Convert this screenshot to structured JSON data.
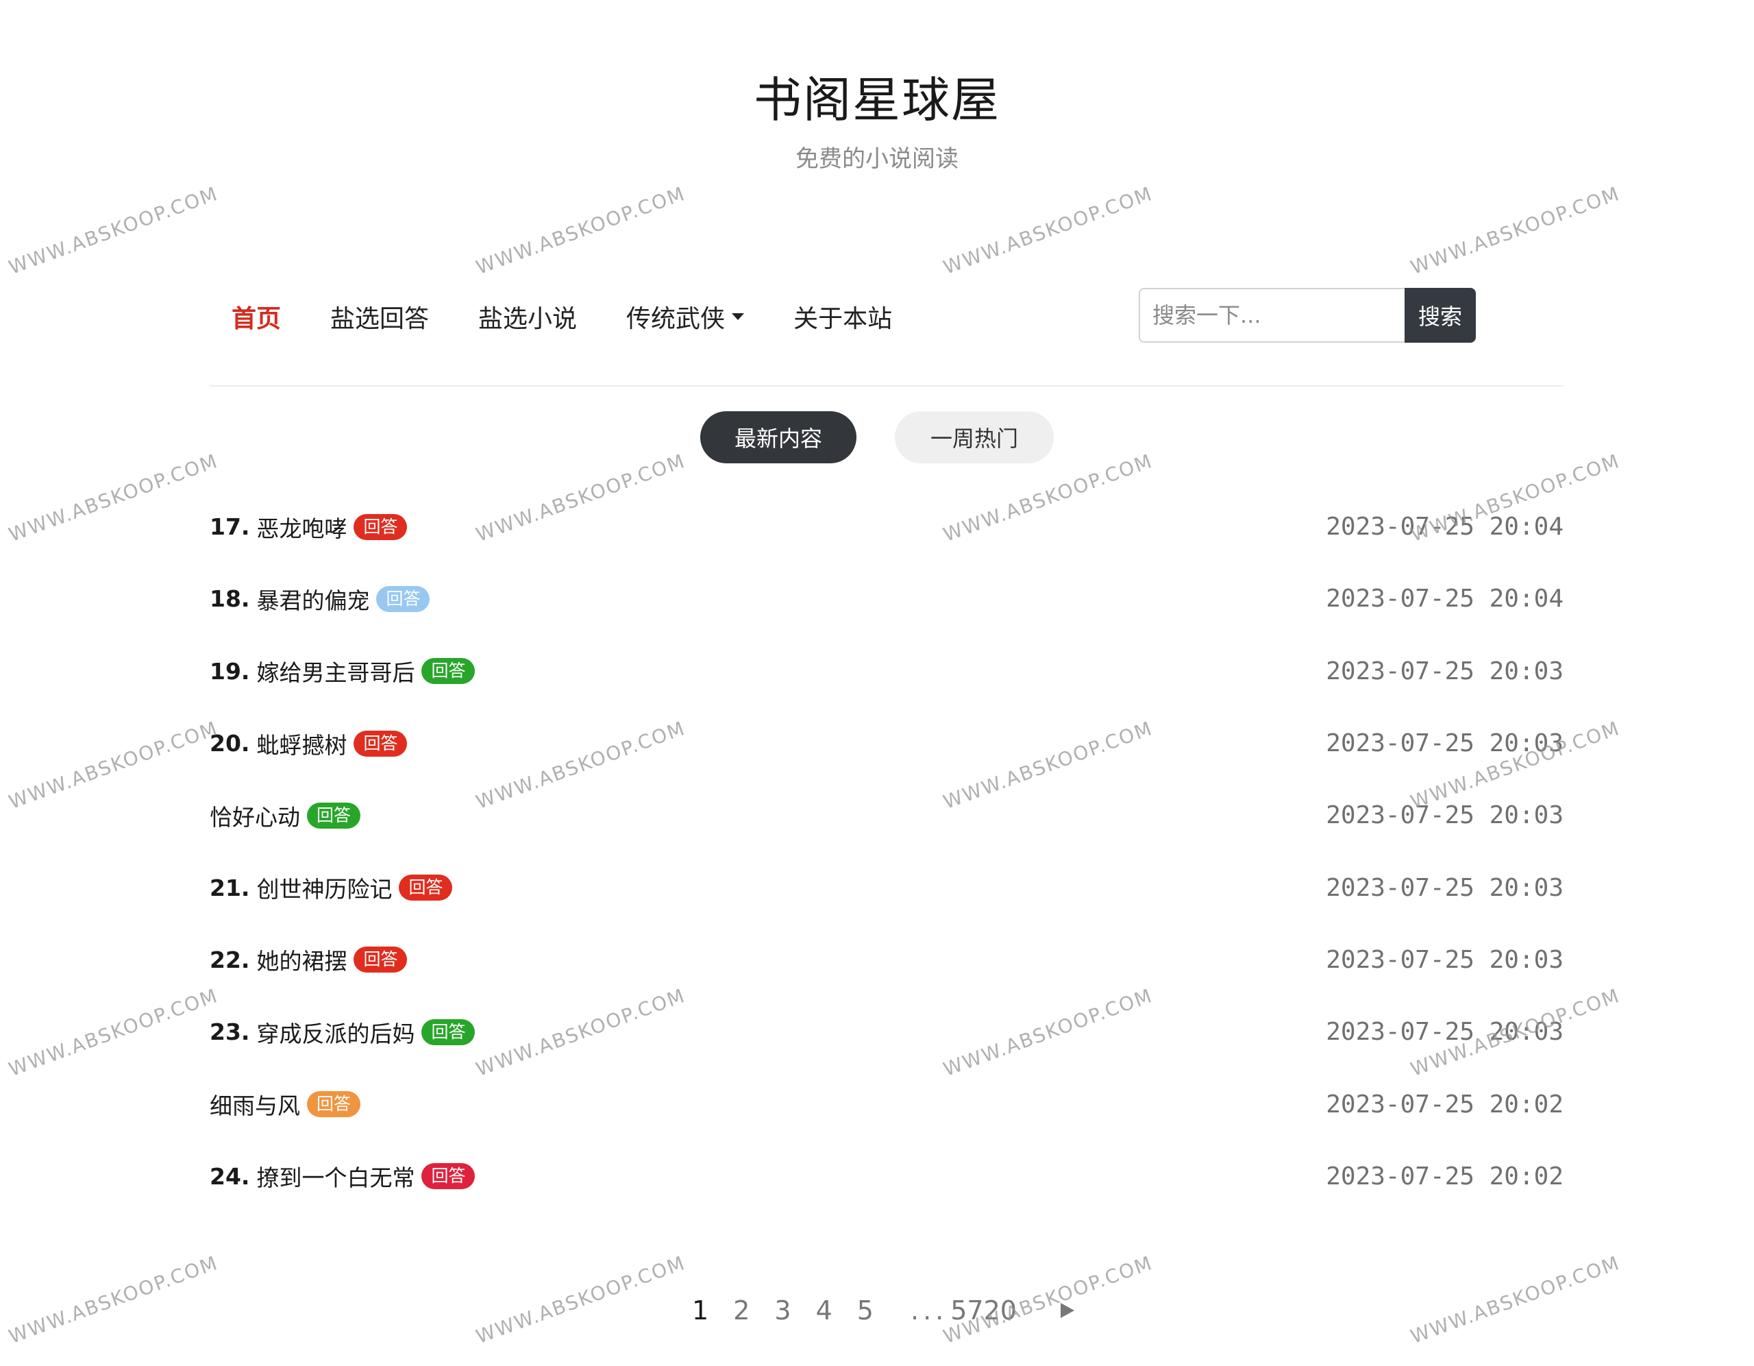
{
  "header": {
    "title": "书阁星球屋",
    "subtitle": "免费的小说阅读"
  },
  "nav": {
    "items": [
      {
        "label": "首页",
        "active": true
      },
      {
        "label": "盐选回答",
        "active": false
      },
      {
        "label": "盐选小说",
        "active": false
      },
      {
        "label": "传统武侠",
        "active": false,
        "dropdown": true
      },
      {
        "label": "关于本站",
        "active": false
      }
    ]
  },
  "search": {
    "placeholder": "搜索一下...",
    "button_label": "搜索"
  },
  "tabs": [
    {
      "label": "最新内容",
      "active": true
    },
    {
      "label": "一周热门",
      "active": false
    }
  ],
  "colors": {
    "accent": "#d42a1e",
    "dark": "#343a40",
    "badge_red": "#e02d1f",
    "badge_blue": "#98c8f2",
    "badge_green": "#28a62a",
    "badge_orange": "#f19440",
    "badge_crimson": "#e0213d"
  },
  "list": [
    {
      "num": "17.",
      "title": "恶龙咆哮",
      "badge": "回答",
      "badge_color": "#e02d1f",
      "time": "2023-07-25 20:04"
    },
    {
      "num": "18.",
      "title": "暴君的偏宠",
      "badge": "回答",
      "badge_color": "#98c8f2",
      "time": "2023-07-25 20:04"
    },
    {
      "num": "19.",
      "title": "嫁给男主哥哥后",
      "badge": "回答",
      "badge_color": "#28a62a",
      "time": "2023-07-25 20:03"
    },
    {
      "num": "20.",
      "title": "蚍蜉撼树",
      "badge": "回答",
      "badge_color": "#e02d1f",
      "time": "2023-07-25 20:03"
    },
    {
      "num": "",
      "title": "恰好心动",
      "badge": "回答",
      "badge_color": "#28a62a",
      "time": "2023-07-25 20:03"
    },
    {
      "num": "21.",
      "title": "创世神历险记",
      "badge": "回答",
      "badge_color": "#e02d1f",
      "time": "2023-07-25 20:03"
    },
    {
      "num": "22.",
      "title": "她的裙摆",
      "badge": "回答",
      "badge_color": "#e02d1f",
      "time": "2023-07-25 20:03"
    },
    {
      "num": "23.",
      "title": "穿成反派的后妈",
      "badge": "回答",
      "badge_color": "#28a62a",
      "time": "2023-07-25 20:03"
    },
    {
      "num": "",
      "title": "细雨与风",
      "badge": "回答",
      "badge_color": "#f19440",
      "time": "2023-07-25 20:02"
    },
    {
      "num": "24.",
      "title": "撩到一个白无常",
      "badge": "回答",
      "badge_color": "#e0213d",
      "time": "2023-07-25 20:02"
    }
  ],
  "pagination": {
    "pages": [
      "1",
      "2",
      "3",
      "4",
      "5"
    ],
    "current": "1",
    "ellipsis": "...",
    "last": "5720",
    "next_icon": "next-arrow-icon"
  },
  "watermark": {
    "text": "WWW.ABSKOOP.COM"
  }
}
